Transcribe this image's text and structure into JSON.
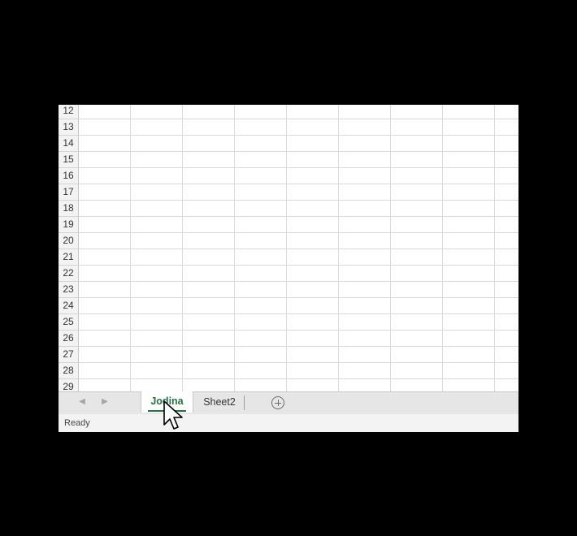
{
  "rows": [
    "12",
    "13",
    "14",
    "15",
    "16",
    "17",
    "18",
    "19",
    "20",
    "21",
    "22",
    "23",
    "24",
    "25",
    "26",
    "27",
    "28",
    "29"
  ],
  "sheet_tabs": {
    "active": "Jodina",
    "other": "Sheet2"
  },
  "icons": {
    "scroll_left": "chevron-left-icon",
    "scroll_right": "chevron-right-icon",
    "new_sheet": "plus-circle-icon",
    "cursor": "arrow-cursor-icon"
  },
  "status": {
    "text": "Ready"
  },
  "colors": {
    "accent": "#217346",
    "background": "#000000"
  }
}
